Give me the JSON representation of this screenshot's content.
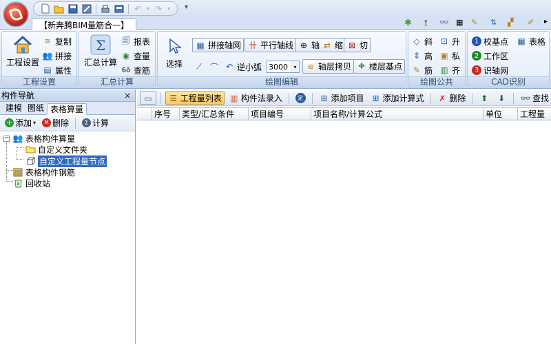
{
  "app": {
    "ribbon_tab": "【新奔腾BIM量筋合一】",
    "qat_more": "▾"
  },
  "ribbon": {
    "groups": {
      "engineering_settings": {
        "label": "工程设置",
        "big_button": "工程设置",
        "buttons": [
          "复制",
          "拼接",
          "属性"
        ]
      },
      "summary": {
        "label": "汇总计算",
        "big_button": "汇总计算",
        "buttons": [
          "报表",
          "查量",
          "查筋"
        ]
      },
      "drawing_edit": {
        "label": "绘图编辑",
        "select_label": "选择",
        "row1": [
          "拼接轴网",
          "平行轴线",
          "轴",
          "缩",
          "切"
        ],
        "row2_arc": "逆小弧",
        "arc_value": "3000",
        "row2": [
          "轴层拷贝",
          "楼层基点"
        ]
      },
      "drawing_public": {
        "label": "绘图公共",
        "items": [
          "斜",
          "升",
          "高",
          "私",
          "筋",
          "齐"
        ]
      },
      "cad": {
        "label": "CAD识别",
        "items": [
          "校基点",
          "表格",
          "工作区",
          "识轴网"
        ],
        "badges": [
          "1",
          "2",
          "3"
        ]
      }
    }
  },
  "nav": {
    "title": "构件导航",
    "close": "×",
    "tabs": [
      "建模",
      "图纸",
      "表格算量"
    ],
    "active_tab": "表格算量",
    "toolbar": {
      "add": "添加",
      "delete": "删除",
      "calc": "计算"
    },
    "tree": {
      "root": "表格构件算量",
      "folder": "自定义文件夹",
      "node": "自定义工程量节点",
      "rebar": "表格构件钢筋",
      "recycle": "回收站"
    }
  },
  "main": {
    "toolbar": {
      "list": "工程量列表",
      "method": "构件法录入",
      "add_item": "添加项目",
      "add_formula": "添加计算式",
      "delete": "删除",
      "find": "查找"
    },
    "columns": [
      "序号",
      "类型/汇总条件",
      "项目编号",
      "项目名称/计算公式",
      "单位",
      "工程量"
    ]
  },
  "colors": {
    "accent": "#316ac5",
    "ribbon_bg": "#dce7f5",
    "active_button": "#ffc95a"
  }
}
